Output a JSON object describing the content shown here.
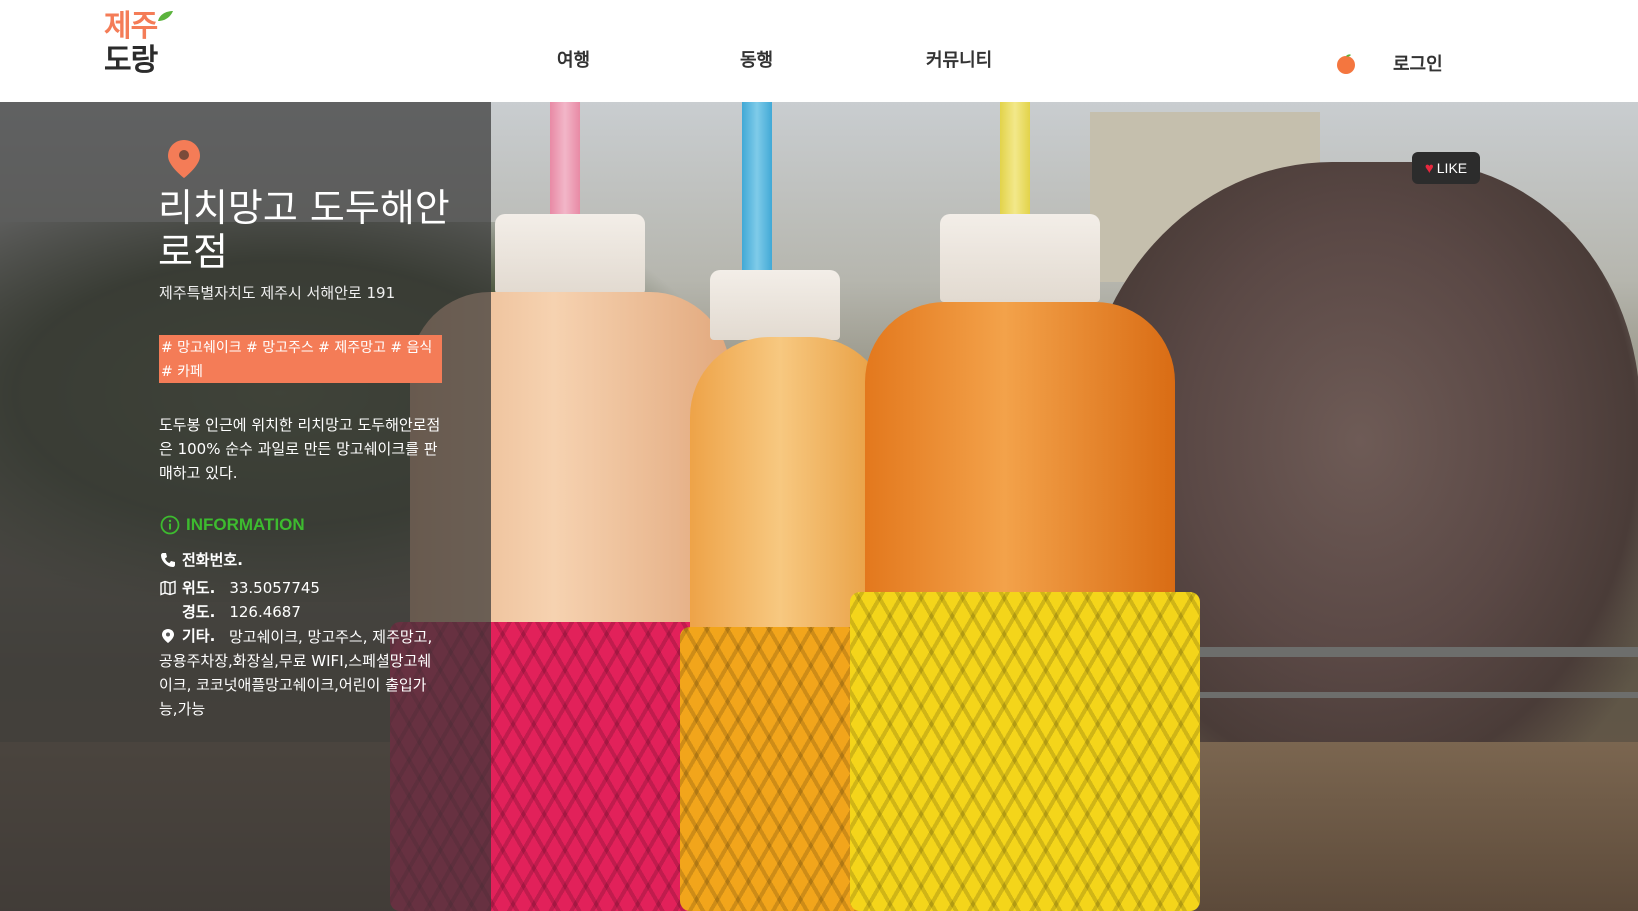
{
  "header": {
    "logo_line1": "제주",
    "logo_line2": "도랑",
    "nav": [
      "여행",
      "동행",
      "커뮤니티"
    ],
    "login_label": "로그인"
  },
  "place": {
    "name": "리치망고 도두해안로점",
    "address": "제주특별자치도 제주시 서해안로 191",
    "tags": "# 망고쉐이크 # 망고주스 # 제주망고 # 음식 # 카페",
    "description": "도두봉 인근에 위치한 리치망고 도두해안로점은 100% 순수 과일로 만든 망고쉐이크를 판매하고 있다."
  },
  "info": {
    "heading": "INFORMATION",
    "phone_label": "전화번호.",
    "lat_label": "위도.",
    "lat_value": "33.5057745",
    "lng_label": "경도.",
    "lng_value": "126.4687",
    "etc_label": "기타.",
    "etc_value": "망고쉐이크, 망고주스, 제주망고, 공용주차장,화장실,무료 WIFI,스페셜망고쉐이크, 코코넛애플망고쉐이크,어린이 출입가능,가능"
  },
  "like_label": "LIKE",
  "colors": {
    "accent": "#f47c57",
    "info_green": "#3dbb2f",
    "like_bg": "#2c2c2c",
    "heart": "#e8283e"
  },
  "icons": [
    "leaf-icon",
    "orange-icon",
    "location-pin-icon",
    "info-circle-icon",
    "phone-icon",
    "map-icon",
    "pin-icon",
    "heart-icon"
  ]
}
